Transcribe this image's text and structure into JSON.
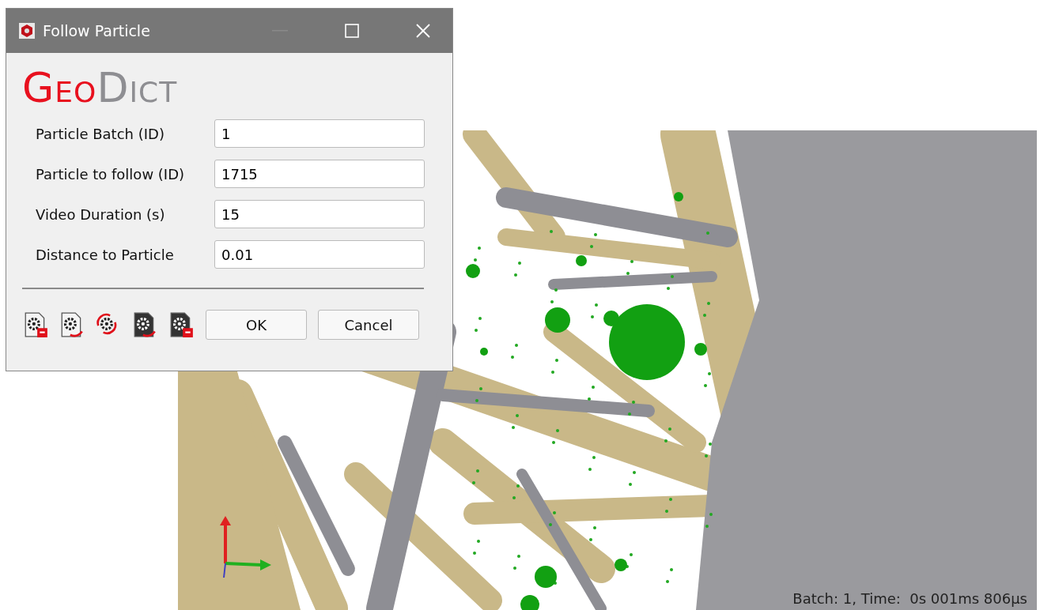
{
  "window": {
    "title": "Follow Particle"
  },
  "logo": {
    "part_1": "Geo",
    "part_2": "Dict"
  },
  "fields": [
    {
      "label": "Particle Batch (ID)",
      "value": "1"
    },
    {
      "label": "Particle to follow (ID)",
      "value": "1715"
    },
    {
      "label": "Video Duration (s)",
      "value": "15"
    },
    {
      "label": "Distance to Particle",
      "value": "0.01"
    }
  ],
  "buttons": [
    "OK",
    "Cancel"
  ],
  "viewer": {
    "status": "Batch: 1, Time:  0s 001ms 806µs"
  }
}
